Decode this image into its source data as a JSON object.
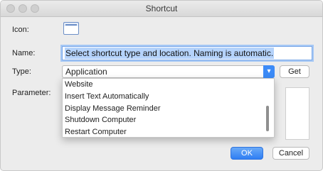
{
  "window": {
    "title": "Shortcut"
  },
  "labels": {
    "icon": "Icon:",
    "name": "Name:",
    "type": "Type:",
    "parameter": "Parameter:"
  },
  "name_field": {
    "value": "Select shortcut type and location. Naming is automatic."
  },
  "type_select": {
    "value": "Application",
    "options_visible": [
      "Website",
      "Insert Text Automatically",
      "Display Message Reminder",
      "Shutdown Computer",
      "Restart Computer"
    ]
  },
  "buttons": {
    "get": "Get",
    "ok": "OK",
    "cancel": "Cancel"
  },
  "icons": {
    "window_icon": "window-icon",
    "dropdown_arrow": "chevron-down-icon"
  },
  "colors": {
    "accent": "#3c8bf7",
    "selection": "#b5d3fb"
  }
}
